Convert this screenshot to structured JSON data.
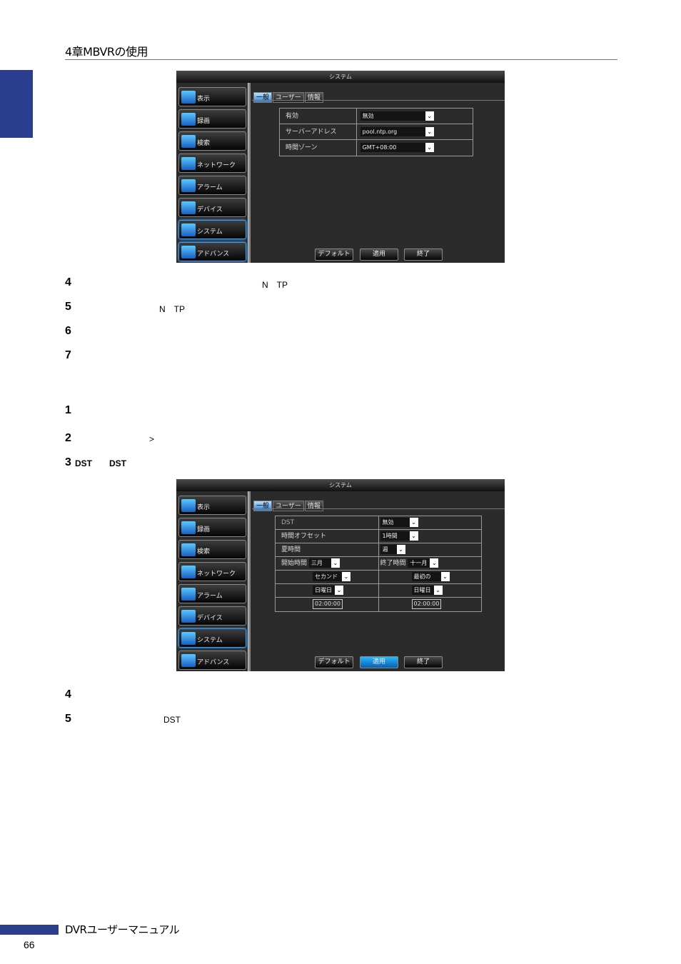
{
  "header": {
    "chapter_title": "4章MBVRの使用"
  },
  "screen1": {
    "title": "システム",
    "menu": [
      "表示",
      "録画",
      "検索",
      "ネットワーク",
      "アラーム",
      "デバイス",
      "システム",
      "アドバンス"
    ],
    "tabs": [
      "一般",
      "ユーザー",
      "情報"
    ],
    "rows": [
      {
        "label": "有効",
        "value": "無効"
      },
      {
        "label": "サーバーアドレス",
        "value": "pool.ntp.org"
      },
      {
        "label": "時間ゾーン",
        "value": "GMT+08:00"
      }
    ],
    "buttons": {
      "default": "デフォルト",
      "apply": "適用",
      "exit": "終了"
    }
  },
  "steps1": [
    {
      "num": "4",
      "note": "N　TP"
    },
    {
      "num": "5",
      "note": "N　TP"
    },
    {
      "num": "6"
    },
    {
      "num": "7"
    }
  ],
  "steps2": [
    {
      "num": "1"
    },
    {
      "num": "2",
      "note": ">"
    },
    {
      "num": "3",
      "bold1": "DST",
      "bold2": "DST"
    }
  ],
  "screen2": {
    "title": "システム",
    "menu": [
      "表示",
      "録画",
      "検索",
      "ネットワーク",
      "アラーム",
      "デバイス",
      "システム",
      "アドバンス"
    ],
    "tabs": [
      "一般",
      "ユーザー",
      "情報"
    ],
    "dst_label": "DST",
    "dst_value": "無効",
    "offset_label": "時間オフセット",
    "offset_value": "1時間",
    "summer_label": "夏時間",
    "summer_value": "週",
    "start_label": "開始時間",
    "start_month": "三月",
    "end_label": "終了時間",
    "end_month": "十一月",
    "start_week": "セカンド",
    "end_week": "最初の",
    "start_day": "日曜日",
    "end_day": "日曜日",
    "start_time": "02:00:00",
    "end_time": "02:00:00",
    "buttons": {
      "default": "デフォルト",
      "apply": "適用",
      "exit": "終了"
    }
  },
  "steps3": [
    {
      "num": "4"
    },
    {
      "num": "5",
      "note": "DST"
    }
  ],
  "footer": {
    "title": "DVRユーザーマニュアル",
    "page": "66"
  }
}
